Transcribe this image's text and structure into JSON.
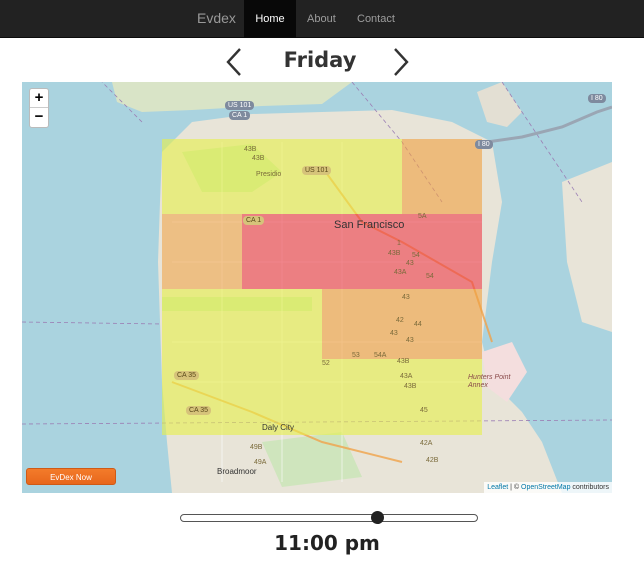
{
  "navbar": {
    "brand": "Evdex",
    "items": [
      {
        "label": "Home",
        "active": true
      },
      {
        "label": "About",
        "active": false
      },
      {
        "label": "Contact",
        "active": false
      }
    ]
  },
  "day_nav": {
    "prev_icon": "chevron-left-icon",
    "next_icon": "chevron-right-icon",
    "day": "Friday"
  },
  "map": {
    "zoom_in": "+",
    "zoom_out": "−",
    "city": "San Francisco",
    "places": {
      "presidio": "Presidio",
      "daly_city": "Daly City",
      "broadmoor": "Broadmoor",
      "hunters_point": "Hunters Point Annex"
    },
    "shields": {
      "us101_ca1_a": "US 101",
      "us101_ca1_b": "CA 1",
      "us101": "US 101",
      "ca1": "CA 1",
      "i80_a": "I 80",
      "i80_b": "I 80",
      "ca35_a": "CA 35",
      "ca35_b": "CA 35"
    },
    "route_labels": [
      "43B",
      "43B",
      "1",
      "43B",
      "54",
      "43",
      "54",
      "5A",
      "43A",
      "43",
      "42",
      "43",
      "53",
      "52",
      "54A",
      "44",
      "43B",
      "43",
      "43A",
      "45",
      "43B",
      "49B",
      "49A",
      "42A",
      "42B",
      "43A",
      "43B",
      "42A",
      "42B"
    ],
    "attribution_leaflet": "Leaflet",
    "attribution_sep": " | © ",
    "attribution_osm": "OpenStreetMap",
    "attribution_rest": " contributors",
    "heat_colors": {
      "yellow": "#e6f04a",
      "orange": "#f0a040",
      "red": "#ee3c4a"
    }
  },
  "evdex_now_button": "EvDex Now",
  "time_slider": {
    "value_fraction": 0.67
  },
  "time": "11:00 pm"
}
